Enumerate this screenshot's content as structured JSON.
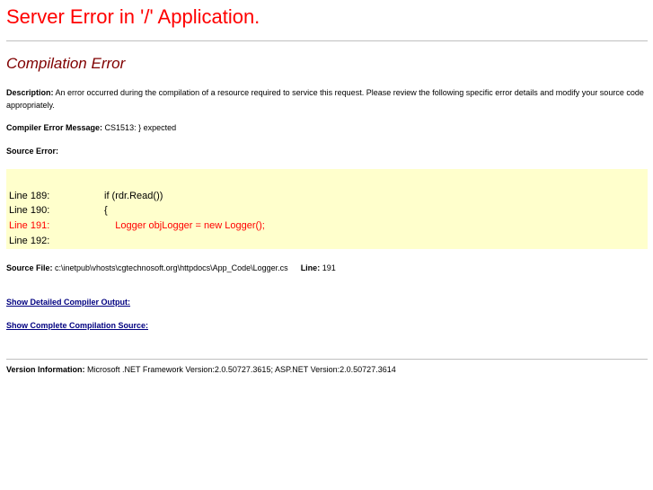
{
  "header": {
    "title": "Server Error in '/' Application."
  },
  "error": {
    "heading": "Compilation Error",
    "description_label": "Description:",
    "description_text": " An error occurred during the compilation of a resource required to service this request. Please review the following specific error details and modify your source code appropriately.",
    "compiler_message_label": "Compiler Error Message:",
    "compiler_message_text": " CS1513: } expected",
    "source_error_label": "Source Error:"
  },
  "source_code": {
    "lines": [
      {
        "number": "Line 189:",
        "code": "if (rdr.Read())",
        "is_error": false
      },
      {
        "number": "Line 190:",
        "code": "{",
        "is_error": false
      },
      {
        "number": "Line 191:",
        "code": "    Logger objLogger = new Logger();",
        "is_error": true
      },
      {
        "number": "Line 192:",
        "code": "",
        "is_error": false
      }
    ],
    "colors": {
      "background": "#ffffcc",
      "error_line": "#ff0000"
    }
  },
  "source_file": {
    "label": "Source File:",
    "path": " c:\\inetpub\\vhosts\\cgtechnosoft.org\\httpdocs\\App_Code\\Logger.cs",
    "line_label": "Line:",
    "line_value": " 191"
  },
  "links": {
    "detailed_output": "Show Detailed Compiler Output:",
    "complete_source": "Show Complete Compilation Source:"
  },
  "version": {
    "label": "Version Information:",
    "text": " Microsoft .NET Framework Version:2.0.50727.3615; ASP.NET Version:2.0.50727.3614"
  },
  "theme": {
    "title_color": "#ff0000",
    "heading_color": "#800000",
    "link_color": "#000080"
  }
}
